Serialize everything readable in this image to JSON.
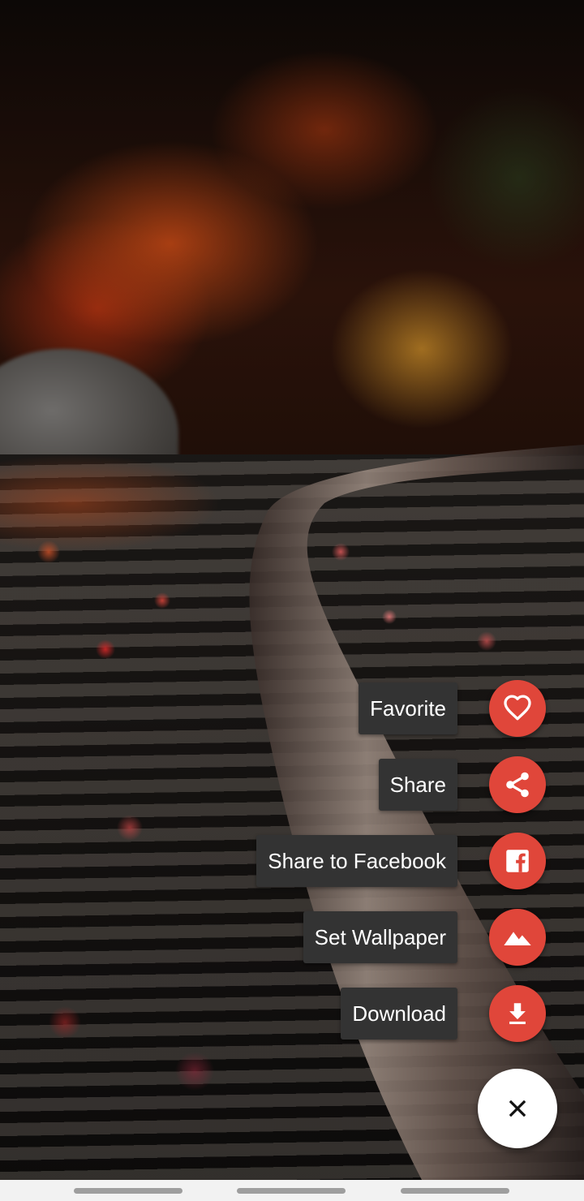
{
  "wallpaper": {
    "description_icon": "autumn-railway-wallpaper"
  },
  "speed_dial": {
    "actions": [
      {
        "label": "Favorite",
        "icon": "heart-outline-icon"
      },
      {
        "label": "Share",
        "icon": "share-icon"
      },
      {
        "label": "Share to Facebook",
        "icon": "facebook-icon"
      },
      {
        "label": "Set Wallpaper",
        "icon": "landscape-icon"
      },
      {
        "label": "Download",
        "icon": "download-icon"
      }
    ],
    "close_icon": "close-icon",
    "action_color": "#e0463a",
    "label_background": "#333333",
    "close_button_color": "#ffffff"
  },
  "nav_bar": {
    "background": "#f2f2f2"
  }
}
